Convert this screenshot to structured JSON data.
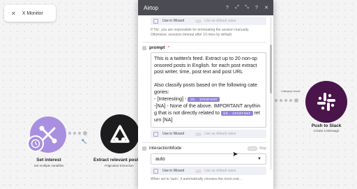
{
  "back_button": {
    "icon": "close-x",
    "label": "X Monitor"
  },
  "modules": [
    {
      "title": "Set interest",
      "subtitle": "Set multiple variables",
      "color": "#a98fe0"
    },
    {
      "title": "Extract relevant posts",
      "subtitle": "Paginated Extraction",
      "color": "#1c1c1e"
    },
    {
      "title": "Push to Slack",
      "subtitle": "Create a Message",
      "color": "#4a154b"
    }
  ],
  "connector_label": "Category found",
  "modal": {
    "title": "Airtop",
    "header_icons": [
      "help-icon",
      "expand-icon",
      "collapse-icon",
      "question-icon",
      "close-icon"
    ],
    "top_wizard": {
      "use_in_wizard": "Use in Wizard",
      "use_default": "Use as default value"
    },
    "session_note": "If 'No', you are responsible for terminating the session manually. Otherwise, sessions timeout after 10 mins by default.",
    "prompt": {
      "label": "prompt",
      "required_mark": "*",
      "lines": {
        "l1": "This is a twitter/x feed. Extract up to 20 non-sp",
        "l2": "onsored posts in English. for each post extract",
        "l3": "post writer, time, post text and post URL",
        "l4": "Also  classify posts based on the following cate",
        "l5": "gories:",
        "l6a": "- [Interesting] - ",
        "pill1": "10. interest",
        "l7": "-[NA] - None of the above. IMPORTANT anythin",
        "l8a": "g that is not directly related to ",
        "pill2": "10. interest",
        "l8b": " ret",
        "l9": "urn [NA]"
      }
    },
    "prompt_wizard": {
      "use_in_wizard": "Use in Wizard",
      "use_default": "Use as default value"
    },
    "interaction_mode": {
      "label": "interactionMode",
      "map_label": "Map",
      "value": "auto"
    },
    "mode_wizard": {
      "use_in_wizard": "Use in Wizard",
      "use_default": "Use as default value"
    },
    "bottom_note": "When set to 'auto', it automatically chooses the most cost..."
  }
}
